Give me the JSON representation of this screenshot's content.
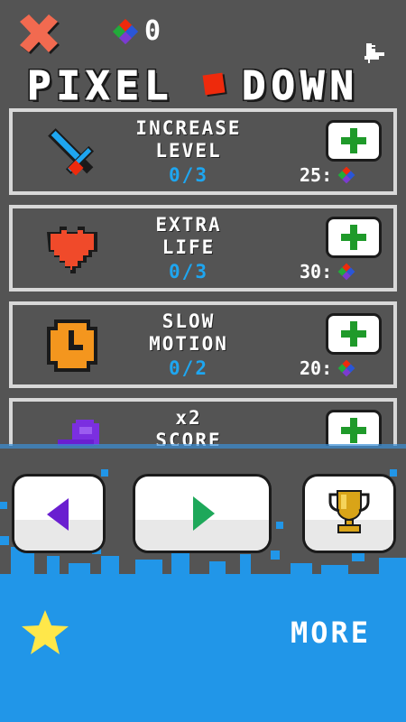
{
  "header": {
    "gem_count": "0",
    "title_left": "PIXEL",
    "title_right": "DOWN"
  },
  "upgrades": [
    {
      "name_line1": "INCREASE",
      "name_line2": "LEVEL",
      "progress": "0/3",
      "price": "25:",
      "icon": "sword-icon"
    },
    {
      "name_line1": "EXTRA",
      "name_line2": "LIFE",
      "progress": "0/3",
      "price": "30:",
      "icon": "heart-icon"
    },
    {
      "name_line1": "SLOW",
      "name_line2": "MOTION",
      "progress": "0/2",
      "price": "20:",
      "icon": "clock-icon"
    },
    {
      "name_line1": "x2",
      "name_line2": "SCORE",
      "progress": "",
      "price": "",
      "icon": "purple-blob-icon"
    }
  ],
  "footer": {
    "more_label": "MORE"
  },
  "colors": {
    "background": "#545454",
    "card_border": "#d8d8d8",
    "progress_text": "#1ea6f0",
    "plus_green": "#1f9a2a",
    "water_blue": "#2196e8",
    "cube_red": "#ee2a0c",
    "star_yellow": "#ffe74a"
  }
}
